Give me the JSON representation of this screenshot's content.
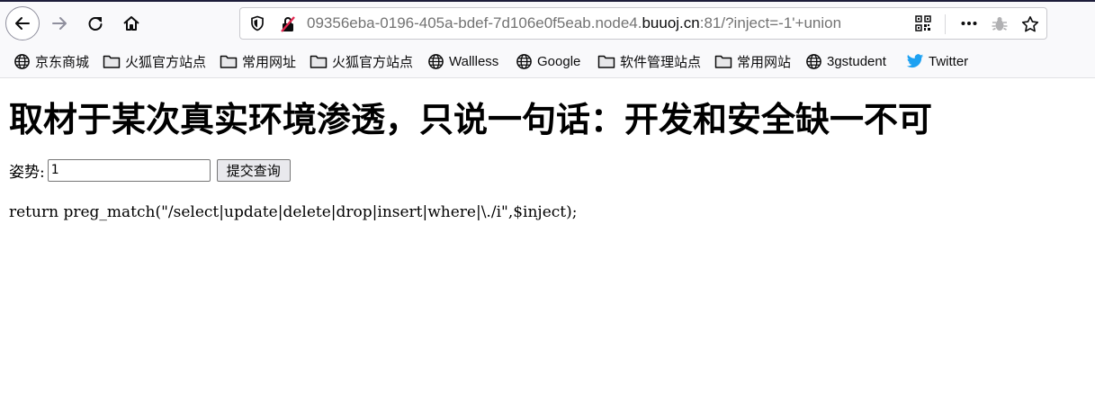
{
  "browser": {
    "url_prefix": "09356eba-0196-405a-bdef-7d106e0f5eab.node4.",
    "url_domain": "buuoj.cn",
    "url_suffix": ":81/?inject=-1'+union",
    "icons": [
      "back-icon",
      "forward-icon",
      "reload-icon",
      "home-icon",
      "shield-icon",
      "insecure-lock-icon",
      "qr-code-icon",
      "more-icon",
      "extension-bug-icon",
      "star-icon"
    ]
  },
  "bookmarks": [
    {
      "label": "京东商城",
      "icon": "globe-icon"
    },
    {
      "label": "火狐官方站点",
      "icon": "folder-icon"
    },
    {
      "label": "常用网址",
      "icon": "folder-icon"
    },
    {
      "label": "火狐官方站点",
      "icon": "folder-icon"
    },
    {
      "label": "Wallless",
      "icon": "globe-icon"
    },
    {
      "label": "Google",
      "icon": "globe-icon"
    },
    {
      "label": "软件管理站点",
      "icon": "folder-icon"
    },
    {
      "label": "常用网站",
      "icon": "folder-icon"
    },
    {
      "label": "3gstudent",
      "icon": "globe-icon"
    },
    {
      "label": "Twitter",
      "icon": "twitter-icon"
    }
  ],
  "page": {
    "title": "取材于某次真实环境渗透，只说一句话：开发和安全缺一不可",
    "form_label": "姿势:",
    "input_value": "1",
    "submit_label": "提交查询",
    "code": "return preg_match(\"/select|update|delete|drop|insert|where|\\./i\",$inject);"
  },
  "colors": {
    "toolbar_bg": "#f9f9fb",
    "insecure_red": "#e22850",
    "twitter_blue": "#1da1f2"
  }
}
